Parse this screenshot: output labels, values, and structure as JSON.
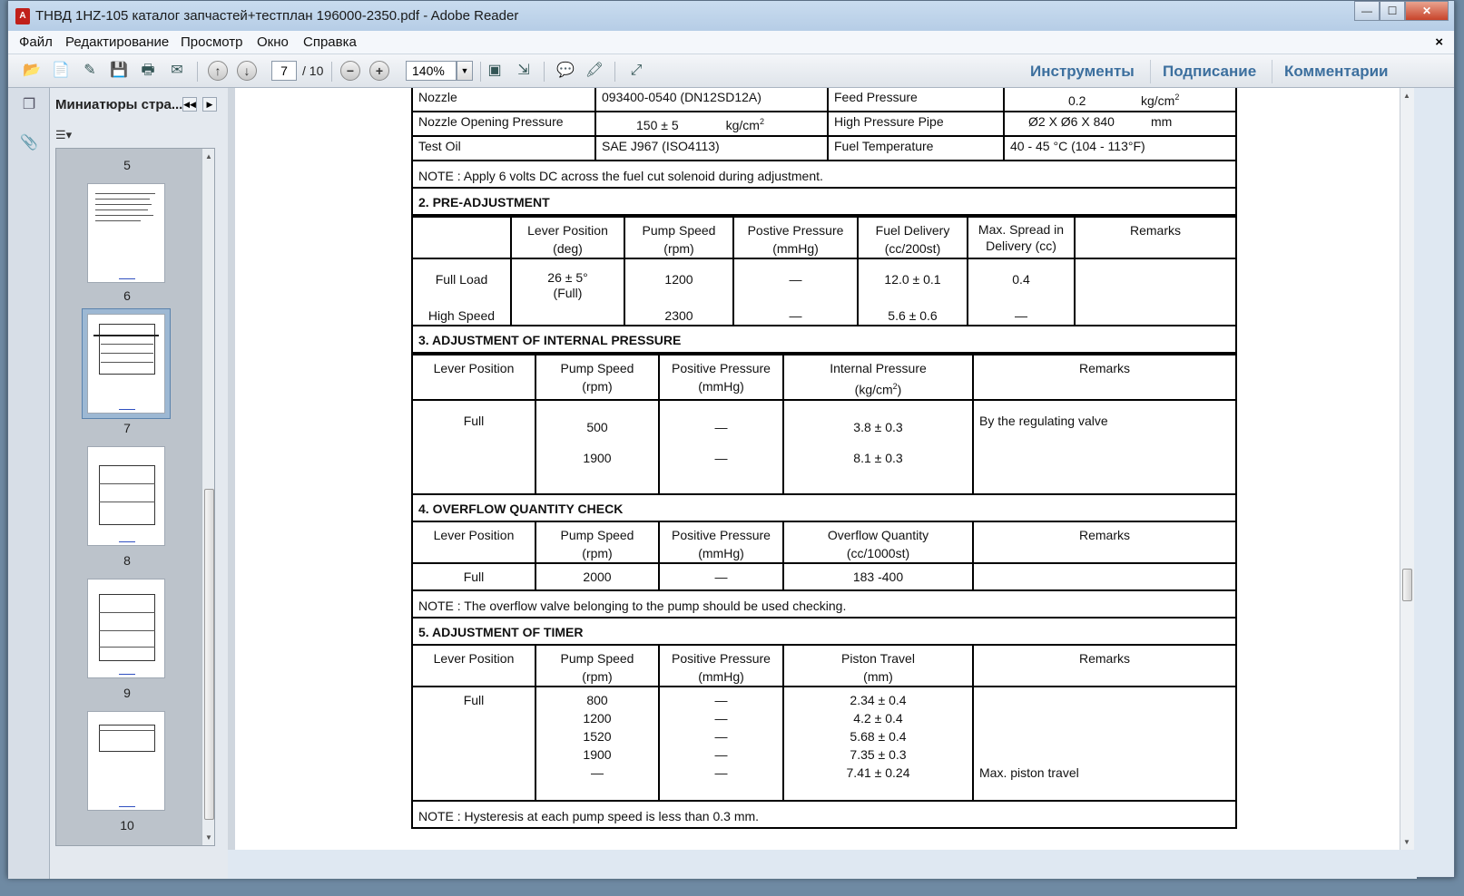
{
  "window": {
    "title": "ТНВД 1HZ-105 каталог запчастей+тестплан 196000-2350.pdf - Adobe Reader",
    "controls": {
      "minimize": "—",
      "maximize": "☐",
      "close": "✕"
    }
  },
  "menu": {
    "items": [
      "Файл",
      "Редактирование",
      "Просмотр",
      "Окно",
      "Справка"
    ],
    "close": "×"
  },
  "toolbar": {
    "page_current": "7",
    "page_total": "/ 10",
    "zoom": "140%",
    "links": [
      "Инструменты",
      "Подписание",
      "Комментарии"
    ]
  },
  "thumbnails": {
    "title": "Миниатюры стра...",
    "pages": [
      "5",
      "6",
      "7",
      "8",
      "9",
      "10"
    ],
    "selected": "7"
  },
  "doc": {
    "top_rows": [
      {
        "a": "Nozzle",
        "b": "093400-0540 (DN12SD12A)",
        "c": "Feed Pressure",
        "d_val": "0.2",
        "d_unit": "kg/cm",
        "d_sup": "2"
      },
      {
        "a": "Nozzle Opening Pressure",
        "b_val": "150 ± 5",
        "b_unit": "kg/cm",
        "b_sup": "2",
        "c": "High Pressure Pipe",
        "d_val": "Ø2 X Ø6 X 840",
        "d_unit": "mm"
      },
      {
        "a": "Test Oil",
        "b": "SAE J967 (ISO4113)",
        "c": "Fuel Temperature",
        "d": "40 - 45 °C (104 - 113°F)"
      }
    ],
    "note1": "NOTE : Apply 6 volts DC across the fuel cut solenoid during adjustment.",
    "pre": {
      "title": "2. PRE-ADJUSTMENT",
      "h_lever": "Lever Position",
      "h_lever_unit": "(deg)",
      "h_speed": "Pump Speed",
      "h_speed_unit": "(rpm)",
      "h_press": "Postive Pressure",
      "h_press_unit": "(mmHg)",
      "h_fuel": "Fuel Delivery",
      "h_fuel_unit": "(cc/200st)",
      "h_spread": "Max. Spread in",
      "h_spread_unit": "Delivery (cc)",
      "h_remarks": "Remarks",
      "r1_label": "Full Load",
      "r1_lever": "26 ± 5°",
      "r1_lever_sub": "(Full)",
      "r1_speed": "1200",
      "r1_press": "—",
      "r1_fuel": "12.0 ± 0.1",
      "r1_spread": "0.4",
      "r2_label": "High Speed",
      "r2_speed": "2300",
      "r2_press": "—",
      "r2_fuel": "5.6 ± 0.6",
      "r2_spread": "—"
    },
    "internal": {
      "title": "3. ADJUSTMENT OF INTERNAL PRESSURE",
      "h_lever": "Lever Position",
      "h_speed": "Pump Speed",
      "h_speed_unit": "(rpm)",
      "h_press": "Positive Pressure",
      "h_press_unit": "(mmHg)",
      "h_int": "Internal Pressure",
      "h_int_unit": "(kg/cm",
      "h_int_sup": "2",
      "h_int_close": ")",
      "h_remarks": "Remarks",
      "lever": "Full",
      "speeds": [
        "500",
        "1900"
      ],
      "press": [
        "—",
        "—"
      ],
      "ints": [
        "3.8 ± 0.3",
        "8.1 ± 0.3"
      ],
      "remark": "By the regulating valve"
    },
    "overflow": {
      "title": "4. OVERFLOW QUANTITY CHECK",
      "h_lever": "Lever Position",
      "h_speed": "Pump Speed",
      "h_speed_unit": "(rpm)",
      "h_press": "Positive Pressure",
      "h_press_unit": "(mmHg)",
      "h_qty": "Overflow Quantity",
      "h_qty_unit": "(cc/1000st)",
      "h_remarks": "Remarks",
      "lever": "Full",
      "speed": "2000",
      "press": "—",
      "qty": "183 -400"
    },
    "note2": "NOTE : The overflow valve belonging to the pump should be used checking.",
    "timer": {
      "title": "5. ADJUSTMENT OF TIMER",
      "h_lever": "Lever Position",
      "h_speed": "Pump Speed",
      "h_speed_unit": "(rpm)",
      "h_press": "Positive Pressure",
      "h_press_unit": "(mmHg)",
      "h_travel": "Piston Travel",
      "h_travel_unit": "(mm)",
      "h_remarks": "Remarks",
      "lever": "Full",
      "speeds": [
        "800",
        "1200",
        "1520",
        "1900",
        "—"
      ],
      "press": [
        "—",
        "—",
        "—",
        "—",
        "—"
      ],
      "travels": [
        "2.34 ± 0.4",
        "4.2 ± 0.4",
        "5.68 ± 0.4",
        "7.35 ± 0.3",
        "7.41 ± 0.24"
      ],
      "remark": "Max. piston travel"
    },
    "note3": "NOTE : Hysteresis at each pump speed is less than 0.3 mm."
  }
}
